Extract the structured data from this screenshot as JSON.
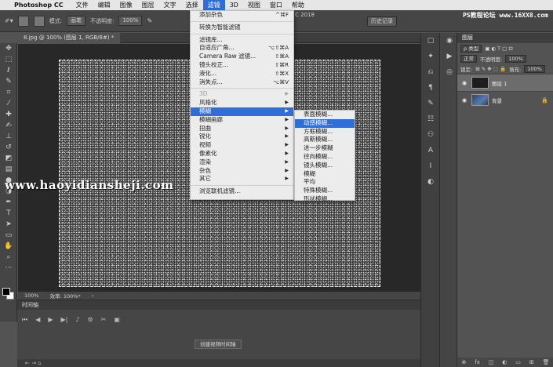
{
  "menubar": {
    "app_name": "Photoshop CC",
    "items": [
      "文件",
      "编辑",
      "图像",
      "图层",
      "文字",
      "选择",
      "滤镜",
      "3D",
      "视图",
      "窗口",
      "帮助"
    ],
    "active_index": 6
  },
  "options_bar": {
    "mode_label": "模式:",
    "mode_value": "画笔",
    "opacity_label": "不透明度:",
    "opacity_value": "100%",
    "title_fragment": "C 2018",
    "history_label": "历史记录"
  },
  "watermark_top": "PS教程论坛 www.16XX8.com",
  "document_tab": "8.jpg @ 100% (图层 1, RGB/8#) *",
  "status_bar": {
    "zoom": "100%",
    "efficiency": "效率: 100%*"
  },
  "filter_menu": {
    "items": [
      {
        "label": "添加杂色",
        "shortcut": "^⌘F"
      },
      {
        "sep": true
      },
      {
        "label": "转换为智能滤镜"
      },
      {
        "sep": true
      },
      {
        "label": "滤镜库..."
      },
      {
        "label": "自适应广角...",
        "shortcut": "⌥⇧⌘A"
      },
      {
        "label": "Camera Raw 滤镜...",
        "shortcut": "⇧⌘A"
      },
      {
        "label": "镜头校正...",
        "shortcut": "⇧⌘R"
      },
      {
        "label": "液化...",
        "shortcut": "⇧⌘X"
      },
      {
        "label": "消失点...",
        "shortcut": "⌥⌘V"
      },
      {
        "sep": true
      },
      {
        "label": "3D",
        "submenu": true,
        "disabled": true
      },
      {
        "label": "风格化",
        "submenu": true
      },
      {
        "label": "模糊",
        "submenu": true,
        "highlighted": true
      },
      {
        "label": "模糊画廊",
        "submenu": true
      },
      {
        "label": "扭曲",
        "submenu": true
      },
      {
        "label": "锐化",
        "submenu": true
      },
      {
        "label": "视频",
        "submenu": true
      },
      {
        "label": "像素化",
        "submenu": true
      },
      {
        "label": "渲染",
        "submenu": true
      },
      {
        "label": "杂色",
        "submenu": true
      },
      {
        "label": "其它",
        "submenu": true
      },
      {
        "sep": true
      },
      {
        "label": "浏览联机滤镜..."
      }
    ]
  },
  "blur_submenu": {
    "items": [
      {
        "label": "表面模糊..."
      },
      {
        "label": "动感模糊...",
        "highlighted": true
      },
      {
        "label": "方框模糊..."
      },
      {
        "label": "高斯模糊..."
      },
      {
        "label": "进一步模糊"
      },
      {
        "label": "径向模糊..."
      },
      {
        "label": "镜头模糊..."
      },
      {
        "label": "模糊"
      },
      {
        "label": "平均"
      },
      {
        "label": "特殊模糊..."
      },
      {
        "label": "形状模糊..."
      }
    ]
  },
  "watermark": "www.haoyidiansheji.com",
  "timeline": {
    "title": "时间轴",
    "create_button": "创建视频时间轴"
  },
  "layers_panel": {
    "tab": "图层",
    "filter_label": "ρ 类型",
    "blend_mode": "正常",
    "opacity_label": "不透明度:",
    "opacity_value": "100%",
    "lock_label": "锁定:",
    "fill_label": "填充:",
    "fill_value": "100%",
    "layers": [
      {
        "name": "图层 1",
        "selected": true,
        "thumb": "dark"
      },
      {
        "name": "背景",
        "selected": false,
        "thumb": "photo",
        "locked": true
      }
    ],
    "footer_icons": [
      "link-icon",
      "fx-icon",
      "mask-icon",
      "adjustment-icon",
      "folder-icon",
      "new-layer-icon",
      "trash-icon"
    ]
  }
}
